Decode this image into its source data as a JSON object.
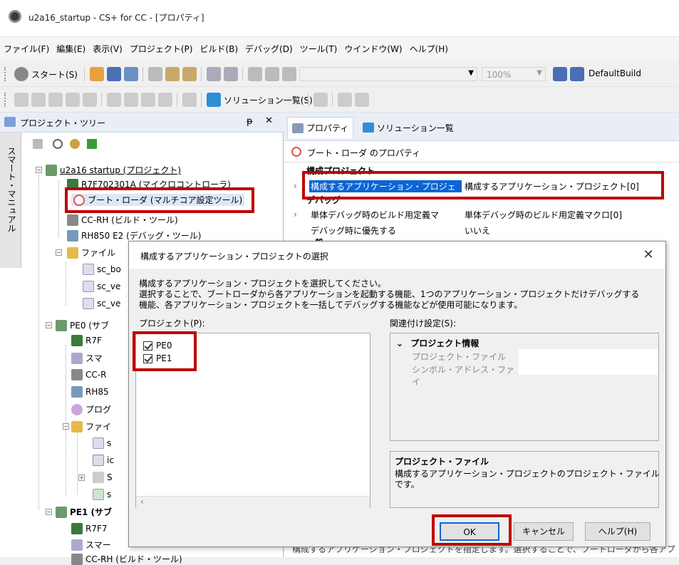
{
  "window": {
    "title": "u2a16_startup - CS+ for CC - [プロパティ]"
  },
  "menubar": {
    "items": [
      "ファイル(F)",
      "編集(E)",
      "表示(V)",
      "プロジェクト(P)",
      "ビルド(B)",
      "デバッグ(D)",
      "ツール(T)",
      "ウインドウ(W)",
      "ヘルプ(H)"
    ]
  },
  "toolbar1": {
    "start_label": "スタート(S)",
    "zoom": "100%",
    "build_config": "DefaultBuild"
  },
  "toolbar2": {
    "solution_list_label": "ソリューション一覧(S)"
  },
  "left_panel": {
    "title": "プロジェクト・ツリー",
    "pin": "ᵽ",
    "close": "✕",
    "vertical_tab": "スマート・マニュアル",
    "tree": [
      "u2a16 startup (プロジェクト)",
      "R7F702301A (マイクロコントローラ)",
      "ブート・ローダ (マルチコア設定ツール)",
      "CC-RH (ビルド・ツール)",
      "RH850 E2 (デバッグ・ツール)",
      "ファイル",
      "sc_bo",
      "sc_ve",
      "sc_ve",
      "PE0 (サブ",
      "R7F",
      "スマ",
      "CC-R",
      "RH85",
      "プログ",
      "ファイ",
      "s",
      "ic",
      "S",
      "s",
      "PE1 (サブ",
      "R7F7",
      "スマー",
      "CC-RH (ビルド・ツール)"
    ]
  },
  "right_panel": {
    "tabs": [
      "プロパティ",
      "ソリューション一覧"
    ],
    "header": "ブート・ローダ のプロパティ",
    "categories": [
      "構成プロジェクト",
      "デバッグ",
      "一般"
    ],
    "rows": [
      {
        "name": "構成するアプリケーション・プロジェ",
        "value": "構成するアプリケーション・プロジェクト[0]"
      },
      {
        "name": "単体デバッグ時のビルド用定義マ",
        "value": "単体デバッグ時のビルド用定義マクロ[0]"
      },
      {
        "name": "デバッグ時に優先する",
        "value": "いいえ"
      }
    ],
    "bottom_note": "構成するアプリケーション・プロジェクトを指定します。選択することで、ブートローダから各アプリケーションを起動する機能、1つのアプリケー"
  },
  "dialog": {
    "title": "構成するアプリケーション・プロジェクトの選択",
    "close": "✕",
    "desc_line1": "構成するアプリケーション・プロジェクトを選択してください。",
    "desc_line2": "選択することで、ブートローダから各アプリケーションを起動する機能、1つのアプリケーション・プロジェクトだけデバッグする",
    "desc_line3": "機能、各アプリケーション・プロジェクトを一括してデバッグする機能などが使用可能になります。",
    "projects_label": "プロジェクト(P):",
    "projects": [
      {
        "name": "PE0",
        "checked": true
      },
      {
        "name": "PE1",
        "checked": true
      }
    ],
    "settings_label": "関連付け設定(S):",
    "settings_category": "プロジェクト情報",
    "settings_rows": [
      "プロジェクト・ファイル",
      "シンボル・アドレス・ファイ"
    ],
    "info_title": "プロジェクト・ファイル",
    "info_line1": "構成するアプリケーション・プロジェクトのプロジェクト・ファイル",
    "info_line2": "です。",
    "ok": "OK",
    "cancel": "キャンセル",
    "help": "ヘルプ(H)"
  },
  "colors": {
    "highlight_red": "#c00000",
    "selection_blue": "#0a64d6",
    "folder_yellow": "#e8b84a"
  }
}
